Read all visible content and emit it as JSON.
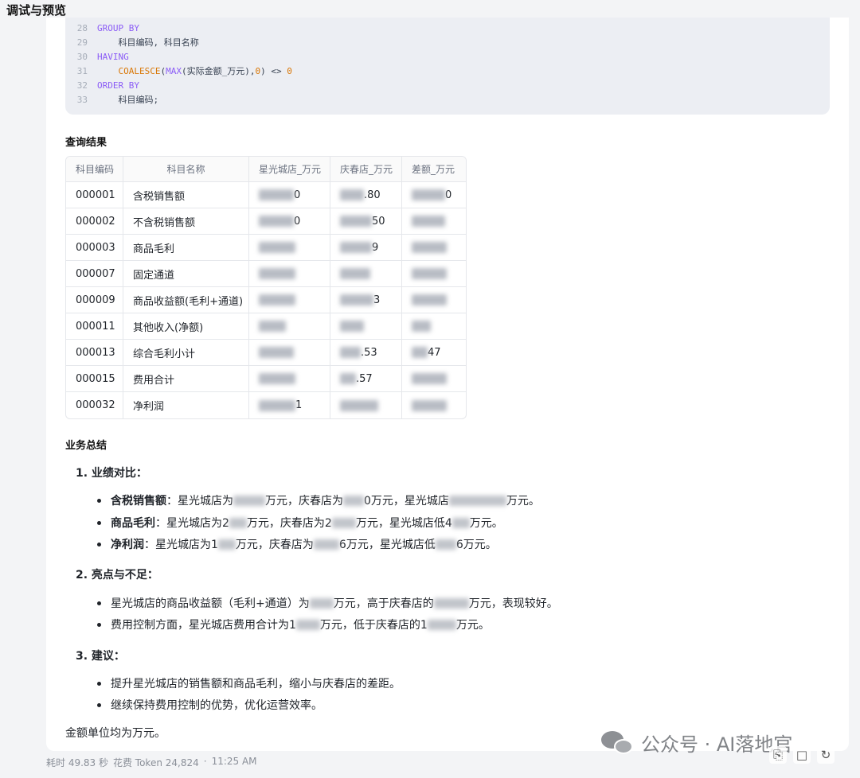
{
  "header": {
    "title": "调试与预览"
  },
  "code": {
    "lines": [
      {
        "num": "28",
        "indent": false,
        "tokens": [
          {
            "t": "GROUP BY",
            "c": "kw"
          }
        ]
      },
      {
        "num": "29",
        "indent": true,
        "tokens": [
          {
            "t": "科目编码, 科目名称",
            "c": "id"
          }
        ]
      },
      {
        "num": "30",
        "indent": false,
        "tokens": [
          {
            "t": "HAVING",
            "c": "kw"
          }
        ]
      },
      {
        "num": "31",
        "indent": true,
        "tokens": [
          {
            "t": "COALESCE",
            "c": "fn"
          },
          {
            "t": "(",
            "c": "id"
          },
          {
            "t": "MAX",
            "c": "kw"
          },
          {
            "t": "(实际金额_万元),",
            "c": "id"
          },
          {
            "t": "0",
            "c": "num"
          },
          {
            "t": ") <> ",
            "c": "id"
          },
          {
            "t": "0",
            "c": "num"
          }
        ]
      },
      {
        "num": "32",
        "indent": false,
        "tokens": [
          {
            "t": "ORDER BY",
            "c": "kw"
          }
        ]
      },
      {
        "num": "33",
        "indent": true,
        "tokens": [
          {
            "t": "科目编码;",
            "c": "id"
          }
        ]
      }
    ]
  },
  "results": {
    "title": "查询结果",
    "columns": [
      "科目编码",
      "科目名称",
      "星光城店_万元",
      "庆春店_万元",
      "差额_万元"
    ],
    "rows": [
      {
        "code": "000001",
        "name": "含税销售额",
        "a": "0",
        "b": ".80",
        "d": "0"
      },
      {
        "code": "000002",
        "name": "不含税销售额",
        "a": "0",
        "b": "50",
        "d": ""
      },
      {
        "code": "000003",
        "name": "商品毛利",
        "a": "",
        "b": "9",
        "d": ""
      },
      {
        "code": "000007",
        "name": "固定通道",
        "a": "",
        "b": "",
        "d": ""
      },
      {
        "code": "000009",
        "name": "商品收益额(毛利+通道)",
        "a": "",
        "b": "3",
        "d": ""
      },
      {
        "code": "000011",
        "name": "其他收入(净额)",
        "a": "",
        "b": "",
        "d": ""
      },
      {
        "code": "000013",
        "name": "综合毛利小计",
        "a": "",
        "b": ".53",
        "d": "47"
      },
      {
        "code": "000015",
        "name": "费用合计",
        "a": "",
        "b": ".57",
        "d": ""
      },
      {
        "code": "000032",
        "name": "净利润",
        "a": "1",
        "b": "",
        "d": ""
      }
    ]
  },
  "summary": {
    "title": "业务总结",
    "sections": [
      {
        "heading": "1. 业绩对比：",
        "bullets": [
          {
            "bold": "含税销售额",
            "parts": [
              "：星光城店为",
              "万元，庆春店为",
              "0万元，星光城店",
              "万元。"
            ]
          },
          {
            "bold": "商品毛利",
            "parts": [
              "：星光城店为2",
              "万元，庆春店为2",
              "万元，星光城店低4",
              "万元。"
            ]
          },
          {
            "bold": "净利润",
            "parts": [
              "：星光城店为1",
              "万元，庆春店为",
              "6万元，星光城店低",
              "6万元。"
            ]
          }
        ]
      },
      {
        "heading": "2. 亮点与不足：",
        "bullets": [
          {
            "bold": "",
            "parts": [
              "星光城店的商品收益额（毛利+通道）为",
              "万元，高于庆春店的",
              "万元，表现较好。"
            ]
          },
          {
            "bold": "",
            "parts": [
              "费用控制方面，星光城店费用合计为1",
              "万元，低于庆春店的1",
              "万元。"
            ]
          }
        ]
      },
      {
        "heading": "3. 建议：",
        "bullets": [
          {
            "bold": "",
            "parts": [
              "提升星光城店的销售额和商品毛利，缩小与庆春店的差距。"
            ]
          },
          {
            "bold": "",
            "parts": [
              "继续保持费用控制的优势，优化运营效率。"
            ]
          }
        ]
      }
    ],
    "note": "金额单位均为万元。"
  },
  "footer": {
    "elapsed": "耗时 49.83 秒",
    "tokens": "花费 Token 24,824",
    "sep": "·",
    "time": "11:25 AM"
  },
  "watermark": {
    "text": "公众号 · AI落地官"
  },
  "icons": {
    "copy": "copy-icon",
    "share": "share-icon",
    "refresh": "refresh-icon"
  }
}
